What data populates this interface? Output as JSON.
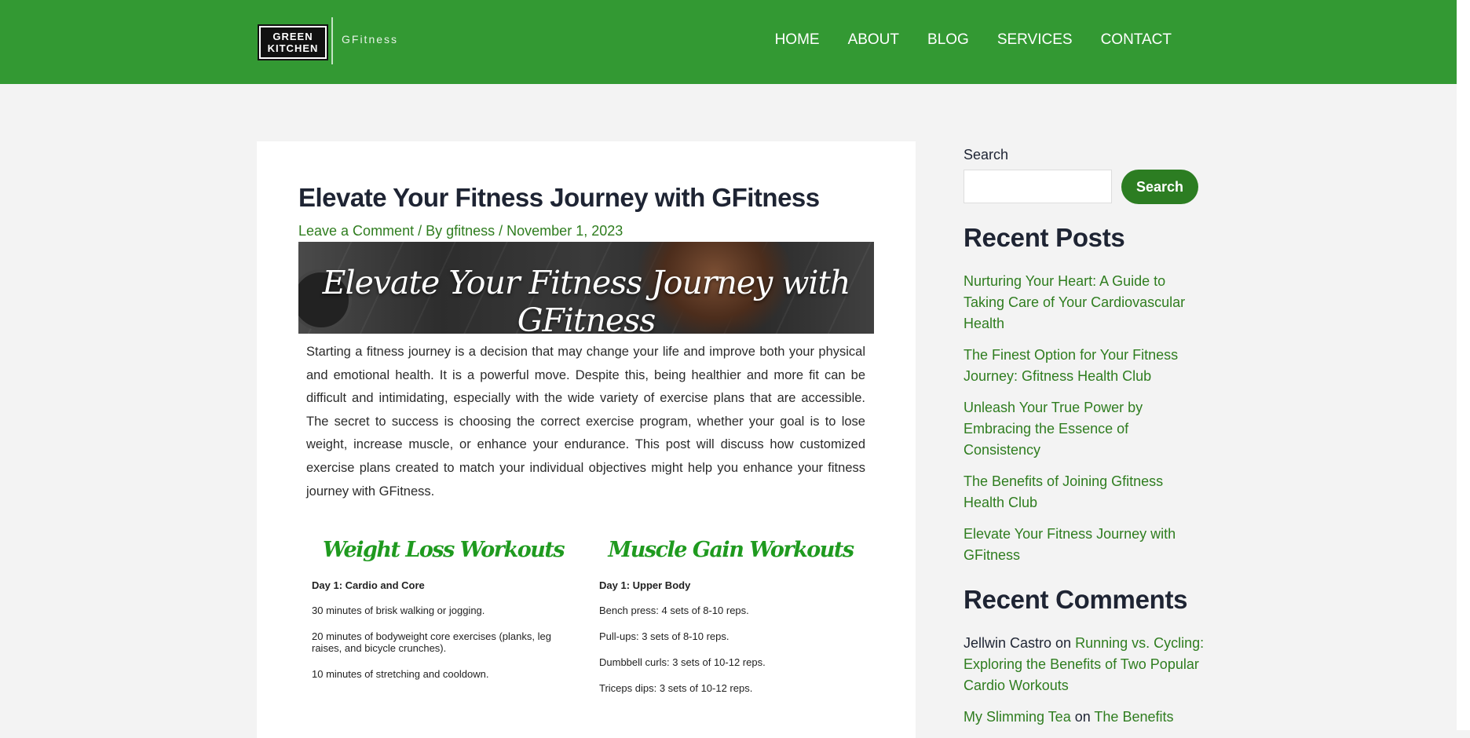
{
  "header": {
    "logo_line1": "GREEN",
    "logo_line2": "KITCHEN",
    "site_name": "GFitness",
    "nav": [
      "HOME",
      "ABOUT",
      "BLOG",
      "SERVICES",
      "CONTACT"
    ]
  },
  "post": {
    "title": "Elevate Your Fitness Journey with GFitness",
    "meta": {
      "comment_link": "Leave a Comment",
      "by": " / By ",
      "author": "gfitness",
      "sep": " / ",
      "date": "November 1, 2023"
    },
    "hero_text": "Elevate Your Fitness Journey with GFitness",
    "intro": "Starting a fitness journey is a decision that may change your life and improve both your physical and emotional health. It is a powerful move. Despite this, being healthier and more fit can be difficult and intimidating, especially with the wide variety of exercise plans that are accessible. The secret to success is choosing the correct exercise program, whether your goal is to lose weight, increase muscle, or enhance your endurance. This post will discuss how customized exercise plans created to match your individual objectives might help you enhance your fitness journey with GFitness.",
    "columns": [
      {
        "title": "Weight Loss Workouts",
        "day": "Day 1: Cardio and Core",
        "items": [
          "30 minutes of brisk walking or jogging.",
          "20 minutes of bodyweight core exercises (planks, leg raises, and bicycle crunches).",
          "10 minutes of stretching and cooldown."
        ]
      },
      {
        "title": "Muscle Gain Workouts",
        "day": "Day 1: Upper Body",
        "items": [
          "Bench press: 4 sets of 8-10 reps.",
          "Pull-ups: 3 sets of 8-10 reps.",
          "Dumbbell curls: 3 sets of 10-12 reps.",
          "Triceps dips: 3 sets of 10-12 reps."
        ]
      }
    ]
  },
  "sidebar": {
    "search_label": "Search",
    "search_value": "",
    "search_button": "Search",
    "recent_posts_title": "Recent Posts",
    "recent_posts": [
      "Nurturing Your Heart: A Guide to Taking Care of Your Cardiovascular Health",
      "The Finest Option for Your Fitness Journey: Gfitness Health Club",
      "Unleash Your True Power by Embracing the Essence of Consistency",
      "The Benefits of Joining Gfitness Health Club",
      "Elevate Your Fitness Journey with GFitness"
    ],
    "recent_comments_title": "Recent Comments",
    "comments": [
      {
        "author": "Jellwin Castro",
        "on": " on ",
        "post": "Running vs. Cycling: Exploring the Benefits of Two Popular Cardio Workouts"
      },
      {
        "author": "My Slimming Tea",
        "on": " on ",
        "post": "The Benefits"
      }
    ]
  },
  "colors": {
    "header_green": "#339933",
    "link_green": "#2f7d1f",
    "button_green": "#2c7d22",
    "script_green": "#1f9a1f"
  }
}
